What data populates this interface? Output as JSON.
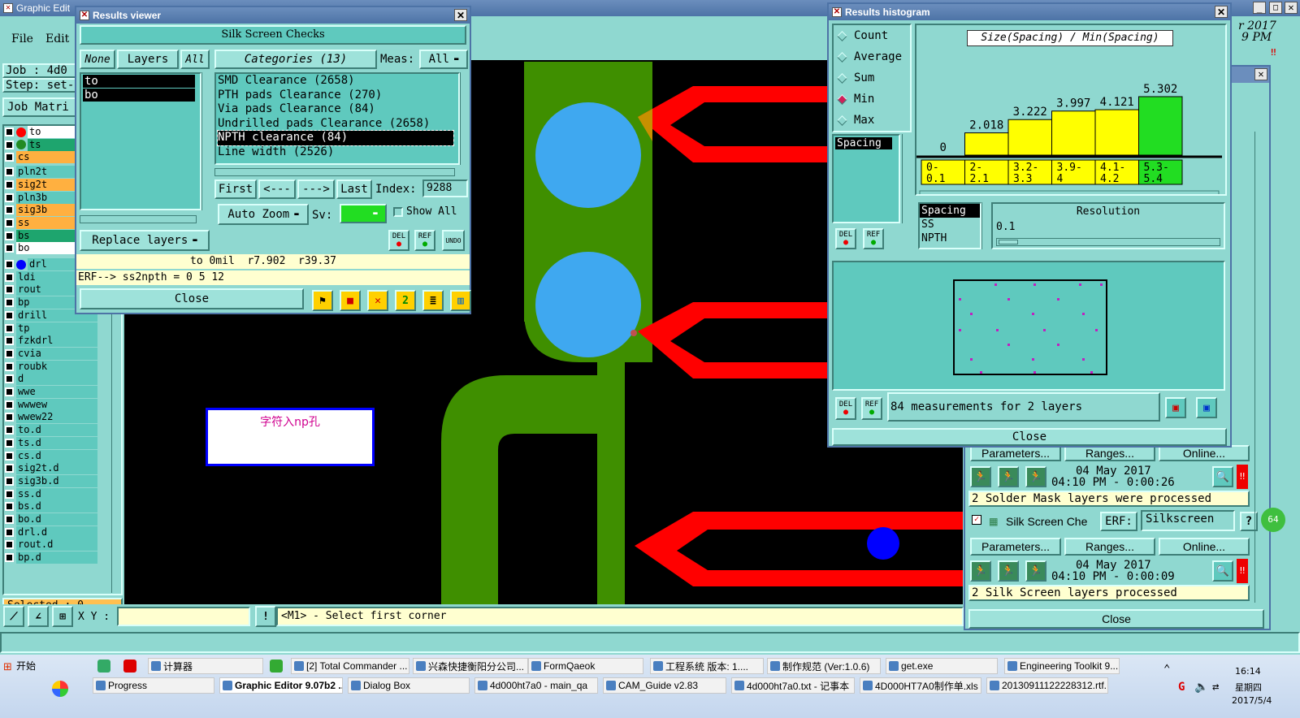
{
  "app": {
    "title": "Graphic Edit",
    "clock_date": "r 2017",
    "clock_time": "9 PM",
    "menu": {
      "file": "File",
      "edit": "Edit"
    },
    "job_label": "Job : 4d0",
    "step_label": "Step: set-",
    "job_matrix": "Job Matri",
    "selected": "Selected : 0"
  },
  "layers": [
    {
      "name": "to",
      "color": "#ffffff",
      "dot": "#ff0000"
    },
    {
      "name": "ts",
      "color": "#1ea56e",
      "dot": "#228b22"
    },
    {
      "name": "cs",
      "color": "#ffb040",
      "dot": ""
    },
    {
      "name": "pln2t",
      "color": "#5fc9be",
      "dot": ""
    },
    {
      "name": "sig2t",
      "color": "#ffb040",
      "dot": ""
    },
    {
      "name": "pln3b",
      "color": "#5fc9be",
      "dot": ""
    },
    {
      "name": "sig3b",
      "color": "#ffb040",
      "dot": ""
    },
    {
      "name": "ss",
      "color": "#ffb040",
      "dot": ""
    },
    {
      "name": "bs",
      "color": "#1ea56e",
      "dot": ""
    },
    {
      "name": "bo",
      "color": "#ffffff",
      "dot": ""
    },
    {
      "name": "drl",
      "color": "#5fc9be",
      "dot": "#0000ff"
    },
    {
      "name": "ldi",
      "color": "#5fc9be",
      "dot": ""
    },
    {
      "name": "rout",
      "color": "#5fc9be",
      "dot": ""
    },
    {
      "name": "bp",
      "color": "#5fc9be",
      "dot": ""
    },
    {
      "name": "drill",
      "color": "#5fc9be",
      "dot": ""
    },
    {
      "name": "tp",
      "color": "#5fc9be",
      "dot": ""
    },
    {
      "name": "fzkdrl",
      "color": "#5fc9be",
      "dot": ""
    },
    {
      "name": "cvia",
      "color": "#5fc9be",
      "dot": ""
    },
    {
      "name": "roubk",
      "color": "#5fc9be",
      "dot": ""
    },
    {
      "name": "d",
      "color": "#5fc9be",
      "dot": ""
    },
    {
      "name": "wwe",
      "color": "#5fc9be",
      "dot": ""
    },
    {
      "name": "wwwew",
      "color": "#5fc9be",
      "dot": ""
    },
    {
      "name": "wwew22",
      "color": "#5fc9be",
      "dot": ""
    },
    {
      "name": "to.d",
      "color": "#5fc9be",
      "dot": ""
    },
    {
      "name": "ts.d",
      "color": "#5fc9be",
      "dot": ""
    },
    {
      "name": "cs.d",
      "color": "#5fc9be",
      "dot": ""
    },
    {
      "name": "sig2t.d",
      "color": "#5fc9be",
      "dot": ""
    },
    {
      "name": "sig3b.d",
      "color": "#5fc9be",
      "dot": ""
    },
    {
      "name": "ss.d",
      "color": "#5fc9be",
      "dot": ""
    },
    {
      "name": "bs.d",
      "color": "#5fc9be",
      "dot": ""
    },
    {
      "name": "bo.d",
      "color": "#5fc9be",
      "dot": ""
    },
    {
      "name": "drl.d",
      "color": "#5fc9be",
      "dot": ""
    },
    {
      "name": "rout.d",
      "color": "#5fc9be",
      "dot": ""
    },
    {
      "name": "bp.d",
      "color": "#5fc9be",
      "dot": ""
    }
  ],
  "results_viewer": {
    "title": "Results viewer",
    "header": "Silk Screen Checks",
    "none": "None",
    "layers_label": "Layers",
    "all": "All",
    "categories_label": "Categories (13)",
    "meas_label": "Meas:",
    "meas_value": "All",
    "layer_items": [
      "to",
      "bo"
    ],
    "categories": [
      "SMD Clearance (2658)",
      "PTH pads Clearance (270)",
      "Via pads Clearance (84)",
      "Undrilled pads Clearance (2658)",
      "NPTH clearance (84)",
      "Line width (2526)"
    ],
    "selected_category": 4,
    "first": "First",
    "prev": "<---",
    "next": "--->",
    "last": "Last",
    "index_label": "Index:",
    "index_value": "9288",
    "auto_zoom": "Auto Zoom",
    "sv_label": "Sv:",
    "show_all": "Show All",
    "replace_layers": "Replace layers",
    "del": "DEL",
    "ref": "REF",
    "undo": "UNDO",
    "status": "to 0mil  r7.902  r39.37",
    "erf": "ERF--> ss2npth = 0 5 12",
    "close": "Close"
  },
  "canvas": {
    "annotation": "字符入np孔"
  },
  "histogram": {
    "title": "Results histogram",
    "radio": [
      "Count",
      "Average",
      "Sum",
      "Min",
      "Max"
    ],
    "radio_selected": 3,
    "chart_title": "Size(Spacing) / Min(Spacing)",
    "spacing_item": "Spacing",
    "list2": [
      "Spacing",
      "SS",
      "NPTH"
    ],
    "resolution_label": "Resolution",
    "resolution_value": "0.1",
    "measurements": "84 measurements for 2 layers",
    "close": "Close"
  },
  "chart_data": {
    "type": "bar",
    "title": "Size(Spacing) / Min(Spacing)",
    "categories": [
      "0-\n0.1",
      "2-\n2.1",
      "3.2-\n3.3",
      "3.9-\n4",
      "4.1-\n4.2",
      "5.3-\n5.4"
    ],
    "values": [
      0,
      2.018,
      3.222,
      3.997,
      4.121,
      5.302
    ],
    "value_labels": [
      "0",
      "2.018",
      "3.222",
      "3.997",
      "4.121",
      "5.302"
    ],
    "colors": {
      "bar": "#ffff00",
      "selected": "#22dd22"
    },
    "selected": 5,
    "ylim": [
      0,
      5.302
    ]
  },
  "right_panel": {
    "params": "Parameters...",
    "ranges": "Ranges...",
    "online": "Online...",
    "date1": "04 May 2017",
    "time1": "04:10 PM - 0:00:26",
    "msg1": "2 Solder Mask layers were processed",
    "check_name": "Silk Screen Che",
    "erf_label": "ERF:",
    "erf_value": "Silkscreen",
    "date2": "04 May 2017",
    "time2": "04:10 PM - 0:00:09",
    "msg2": "2 Silk Screen layers processed",
    "close": "Close",
    "help": "?"
  },
  "bottom": {
    "xy_label": "X Y :",
    "prompt": "<M1> - Select first corner"
  },
  "taskbar": {
    "start": "开始",
    "clock": "16:14",
    "weekday": "星期四",
    "date": "2017/5/4",
    "row1": [
      "计算器",
      "[2] Total Commander ...",
      "兴森快捷衡阳分公司...",
      "FormQaeok",
      "工程系统  版本: 1....",
      "制作规范 (Ver:1.0.6)",
      "get.exe",
      "Engineering Toolkit 9...."
    ],
    "row2": [
      "Progress",
      "Graphic Editor 9.07b2 ...",
      "Dialog Box",
      "4d000ht7a0 - main_qa",
      "CAM_Guide v2.83",
      "4d000ht7a0.txt - 记事本",
      "4D000HT7A0制作单.xls ...",
      "20130911122228312.rtf..."
    ]
  }
}
